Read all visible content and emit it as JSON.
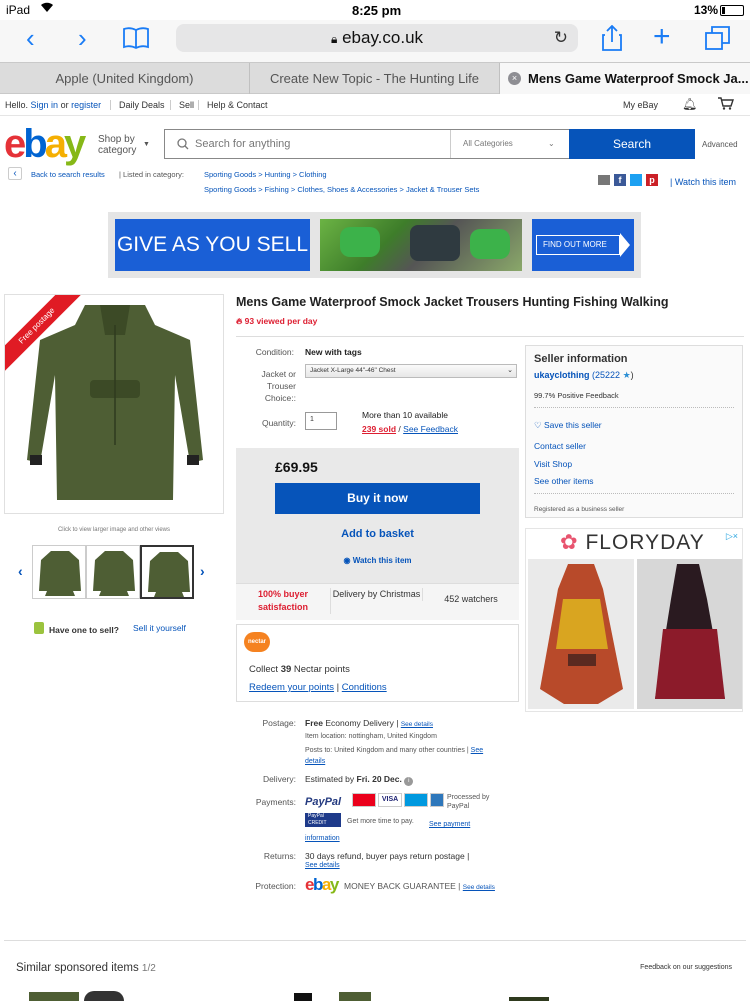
{
  "status": {
    "device": "iPad",
    "time": "8:25 pm",
    "battery": "13%"
  },
  "browser": {
    "url": "ebay.co.uk",
    "tabs": [
      {
        "label": "Apple (United Kingdom)"
      },
      {
        "label": "Create New Topic - The Hunting Life"
      },
      {
        "label": "Mens Game Waterproof Smock Ja..."
      }
    ]
  },
  "header": {
    "hello": "Hello.",
    "sign_in": "Sign in",
    "or": "or",
    "register": "register",
    "deals": "Daily Deals",
    "sell": "Sell",
    "help": "Help & Contact",
    "myebay": "My eBay",
    "shop_by": "Shop by",
    "category": "category",
    "search_placeholder": "Search for anything",
    "all_categories": "All Categories",
    "search_btn": "Search",
    "advanced": "Advanced"
  },
  "crumbs": {
    "back": "Back to search results",
    "listed": "| Listed in category:",
    "line1": "Sporting Goods > Hunting > Clothing",
    "line2": "Sporting Goods > Fishing > Clothes, Shoes & Accessories > Jacket & Trouser Sets",
    "watch": "| Watch this item"
  },
  "banner": {
    "text": "GIVE AS YOU SELL",
    "cta": "FIND OUT MORE"
  },
  "gallery": {
    "ribbon": "Free postage",
    "hint": "Click to view larger image and other views"
  },
  "item": {
    "title": "Mens Game Waterproof Smock Jacket Trousers Hunting Fishing Walking",
    "viewed": "93 viewed per day",
    "condition_label": "Condition:",
    "condition": "New with tags",
    "choice_label": "Jacket or Trouser Choice::",
    "choice_value": "Jacket X-Large 44\"-46\" Chest",
    "quantity_label": "Quantity:",
    "quantity": "1",
    "available": "More than 10 available",
    "sold": "239 sold",
    "slash": "/",
    "see_feedback": "See Feedback",
    "price": "£69.95",
    "buy_now": "Buy it now",
    "add_basket": "Add to basket",
    "watch": "Watch this item",
    "satisfaction": "100% buyer satisfaction",
    "delivery_by": "Delivery by Christmas",
    "watchers": "452 watchers"
  },
  "nectar": {
    "logo": "nectar",
    "collect_pre": "Collect",
    "points": "39",
    "collect_post": "Nectar points",
    "redeem": "Redeem your points",
    "sep": "|",
    "conditions": "Conditions"
  },
  "sell": {
    "have_one": "Have one to sell?",
    "sell_it": "Sell it yourself"
  },
  "seller": {
    "heading": "Seller information",
    "name": "ukayclothing",
    "score": "(25222",
    "score_end": ")",
    "positive": "99.7% Positive Feedback",
    "save": "Save this seller",
    "contact": "Contact seller",
    "visit": "Visit Shop",
    "other": "See other items",
    "registered": "Registered as a business seller"
  },
  "ad": {
    "brand": "FLORYDAY"
  },
  "shipping": {
    "postage_label": "Postage:",
    "free": "Free",
    "economy": "Economy Delivery",
    "see_details": "See details",
    "location": "Item location:  nottingham, United Kingdom",
    "posts_to": "Posts to:  United Kingdom and many other countries",
    "delivery_label": "Delivery:",
    "delivery_pre": "Estimated by",
    "delivery_date": "Fri. 20 Dec.",
    "payments_label": "Payments:",
    "paypal": "PayPal",
    "processed": "Processed by PayPal",
    "credit_text": "Get more time to pay.",
    "see_payment": "See payment information",
    "returns_label": "Returns:",
    "returns": "30 days refund, buyer pays return postage |",
    "protection_label": "Protection:",
    "guarantee": "MONEY BACK GUARANTEE",
    "pipe": "|"
  },
  "footer": {
    "similar": "Similar sponsored items",
    "page": "1/2",
    "feedback": "Feedback on our suggestions"
  },
  "colors": {
    "accent": "#0654ba",
    "ebay_red": "#e53238",
    "ebay_blue": "#0064d2",
    "ebay_yellow": "#f5af02",
    "ebay_green": "#86b817",
    "jacket": "#4e5e34"
  }
}
